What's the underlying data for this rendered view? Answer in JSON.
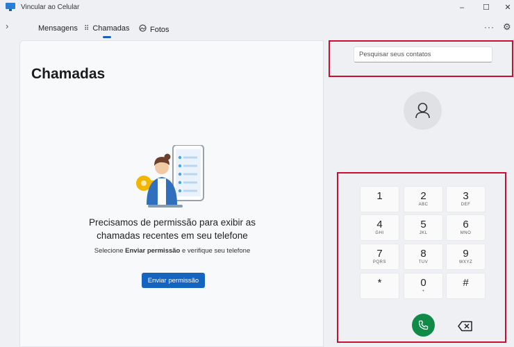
{
  "window": {
    "title": "Vincular ao Celular",
    "controls": {
      "minimize": "–",
      "maximize": "☐",
      "close": "✕"
    }
  },
  "nav": {
    "back_glyph": "›",
    "tabs": [
      {
        "label": "Mensagens",
        "icon": "",
        "selected": false
      },
      {
        "label": "Chamadas",
        "icon": "dialpad-icon",
        "selected": true
      },
      {
        "label": "Fotos",
        "icon": "photos-icon",
        "selected": false
      }
    ],
    "more_glyph": "···",
    "settings_glyph": "⚙"
  },
  "calls": {
    "title": "Chamadas",
    "permission_title_line1": "Precisamos de permissão para exibir as",
    "permission_title_line2": "chamadas recentes em seu telefone",
    "permission_sub_pre": "Selecione ",
    "permission_sub_bold": "Enviar permissão",
    "permission_sub_post": " e verifique seu telefone",
    "permission_button": "Enviar permissão"
  },
  "dialer": {
    "search_placeholder": "Pesquisar seus contatos",
    "keys": [
      {
        "num": "1",
        "letters": ""
      },
      {
        "num": "2",
        "letters": "ABC"
      },
      {
        "num": "3",
        "letters": "DEF"
      },
      {
        "num": "4",
        "letters": "GHI"
      },
      {
        "num": "5",
        "letters": "JKL"
      },
      {
        "num": "6",
        "letters": "MNO"
      },
      {
        "num": "7",
        "letters": "PQRS"
      },
      {
        "num": "8",
        "letters": "TUV"
      },
      {
        "num": "9",
        "letters": "WXYZ"
      },
      {
        "num": "*",
        "letters": ""
      },
      {
        "num": "0",
        "letters": "+"
      },
      {
        "num": "#",
        "letters": ""
      }
    ]
  },
  "colors": {
    "accent": "#1565c0",
    "call_green": "#0f8a47",
    "annotation_red": "#c8102e"
  }
}
